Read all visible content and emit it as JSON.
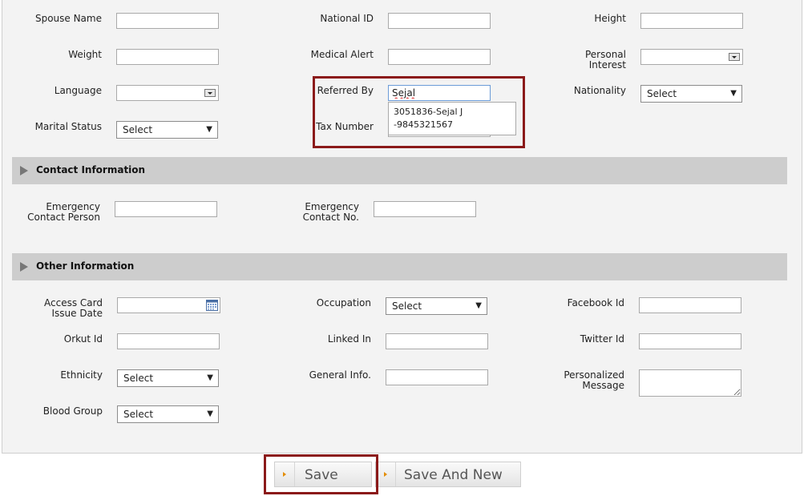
{
  "personal": {
    "spouse_name_label": "Spouse Name",
    "national_id_label": "National ID",
    "height_label": "Height",
    "weight_label": "Weight",
    "medical_alert_label": "Medical Alert",
    "personal_interest_label_1": "Personal",
    "personal_interest_label_2": "Interest",
    "language_label": "Language",
    "referred_by_label": "Referred By",
    "referred_by_value": "Sejal",
    "nationality_label": "Nationality",
    "nationality_value": "Select",
    "marital_status_label": "Marital Status",
    "marital_status_value": "Select",
    "tax_number_label": "Tax Number",
    "suggestion_line_1": "3051836-Sejal J",
    "suggestion_line_2": "-9845321567"
  },
  "contact_section": {
    "title": "Contact Information",
    "emergency_person_label_1": "Emergency",
    "emergency_person_label_2": "Contact Person",
    "emergency_no_label_1": "Emergency",
    "emergency_no_label_2": "Contact No."
  },
  "other_section": {
    "title": "Other Information",
    "access_card_label_1": "Access Card",
    "access_card_label_2": "Issue Date",
    "occupation_label": "Occupation",
    "occupation_value": "Select",
    "facebook_label": "Facebook Id",
    "orkut_label": "Orkut Id",
    "linkedin_label": "Linked In",
    "twitter_label": "Twitter Id",
    "ethnicity_label": "Ethnicity",
    "ethnicity_value": "Select",
    "general_info_label": "General Info.",
    "personalized_label_1": "Personalized",
    "personalized_label_2": "Message",
    "blood_group_label": "Blood Group",
    "blood_group_value": "Select"
  },
  "actions": {
    "save_label": "Save",
    "save_new_label": "Save And New"
  },
  "icons": {
    "dropdown": "chevron-down-icon",
    "calendar": "calendar-icon",
    "expand": "triangle-right-icon",
    "button": "play-small-icon"
  },
  "colors": {
    "highlight": "#8b1a1a",
    "section_bg": "#cdcdcd",
    "panel_bg": "#f3f3f3",
    "button_accent": "#e38c00"
  }
}
